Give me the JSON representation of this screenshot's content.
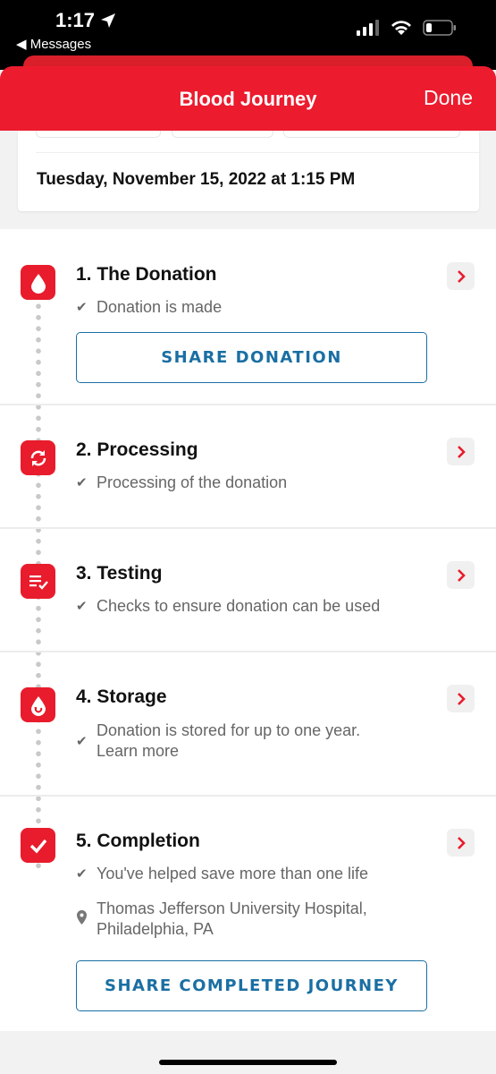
{
  "status_bar": {
    "time": "1:17",
    "back_label": "◀ Messages"
  },
  "header": {
    "title": "Blood Journey",
    "done_label": "Done"
  },
  "date": {
    "text": "Tuesday, November 15, 2022 at 1:15 PM"
  },
  "steps": [
    {
      "title": "1. The Donation",
      "icon": "blood-drop-icon",
      "lines": [
        "Donation is made"
      ],
      "button": "SHARE DONATION"
    },
    {
      "title": "2. Processing",
      "icon": "sync-icon",
      "lines": [
        "Processing of the donation"
      ]
    },
    {
      "title": "3. Testing",
      "icon": "checklist-icon",
      "lines": [
        "Checks to ensure donation can be used"
      ]
    },
    {
      "title": "4. Storage",
      "icon": "drop-storage-icon",
      "lines": [
        "Donation is stored for up to one year.",
        "Learn more"
      ]
    },
    {
      "title": "5. Completion",
      "icon": "checkmark-icon",
      "lines": [
        "You've helped save more than one life"
      ],
      "location": [
        "Thomas Jefferson University Hospital,",
        "Philadelphia, PA"
      ],
      "button": "SHARE COMPLETED JOURNEY"
    }
  ],
  "colors": {
    "brand_red": "#ec1b2e",
    "button_blue": "#1a6fa3"
  }
}
